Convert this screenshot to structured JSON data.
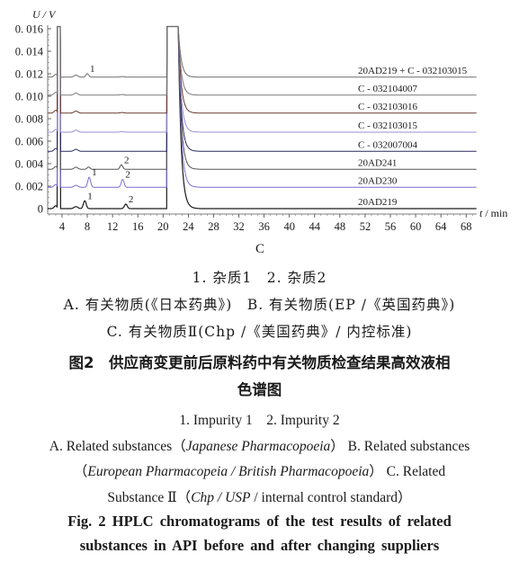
{
  "chart_data": {
    "type": "line",
    "panel": "C",
    "title": "",
    "xlabel": "t / min",
    "ylabel": "U / V",
    "xlim": [
      1.7,
      70
    ],
    "ylim": [
      -0.0005,
      0.016
    ],
    "x_ticks": [
      4,
      8,
      12,
      16,
      20,
      24,
      28,
      32,
      36,
      40,
      44,
      48,
      52,
      56,
      60,
      64,
      68
    ],
    "y_ticks": [
      0,
      0.002,
      0.004,
      0.006,
      0.008,
      0.01,
      0.012,
      0.014,
      0.016
    ],
    "y_tick_labels": [
      "0",
      "0. 002",
      "0. 004",
      "0. 006",
      "0. 008",
      "0. 010",
      "0. 012",
      "0. 014",
      "0. 016"
    ],
    "grid": false,
    "main_peak_time_min": 21.8,
    "solvent_peak_time_min": 3.5,
    "series": [
      {
        "name": "20AD219",
        "baseline": 0.0,
        "color": "#1a1a1a",
        "peaks": [
          {
            "label": "1",
            "time": 7.6,
            "height": 0.0007
          },
          {
            "label": "2",
            "time": 14.1,
            "height": 0.0004
          }
        ]
      },
      {
        "name": "20AD230",
        "baseline": 0.0019,
        "color": "#7b6fcf",
        "peaks": [
          {
            "label": "1",
            "time": 8.3,
            "height": 0.0009
          },
          {
            "label": "2",
            "time": 13.6,
            "height": 0.0007
          }
        ]
      },
      {
        "name": "20AD241",
        "baseline": 0.0035,
        "color": "#555555",
        "peaks": [
          {
            "label": "",
            "time": 8.2,
            "height": 0.0002
          },
          {
            "label": "2",
            "time": 13.4,
            "height": 0.0004
          }
        ]
      },
      {
        "name": "C - 032007004",
        "baseline": 0.0051,
        "color": "#2b2a5e",
        "peaks": []
      },
      {
        "name": "C - 032103015",
        "baseline": 0.0068,
        "color": "#9a8fd6",
        "peaks": []
      },
      {
        "name": "C - 032103016",
        "baseline": 0.0085,
        "color": "#6b3a2f",
        "peaks": []
      },
      {
        "name": "C - 032104007",
        "baseline": 0.0101,
        "color": "#7a7a7a",
        "peaks": []
      },
      {
        "name": "20AD219 + C - 032103015",
        "baseline": 0.0117,
        "color": "#6e6e6e",
        "peaks": [
          {
            "label": "1",
            "time": 8.0,
            "height": 0.0003
          }
        ]
      }
    ]
  },
  "captions": {
    "peak_legend_cn": "1. 杂质1　2. 杂质2",
    "methods_cn_line1": "A. 有关物质(《日本药典》)　B. 有关物质(EP /《英国药典》)",
    "methods_cn_line2": "C. 有关物质Ⅱ(Chp /《美国药典》/ 内控标准)",
    "figure_title_cn_line1": "图2　供应商变更前后原料药中有关物质检查结果高效液相",
    "figure_title_cn_line2": "色谱图",
    "peak_legend_en": "1. Impurity  1　2. Impurity  2",
    "methods_en_line1_a": "A. Related  substances（",
    "methods_en_line1_b": "Japanese  Pharmacopoeia",
    "methods_en_line1_c": "）  B. Related  substances",
    "methods_en_line2_a": "（",
    "methods_en_line2_b": "European  Pharmacopeia / British  Pharmacopoeia",
    "methods_en_line2_c": "）  C. Related",
    "methods_en_line3_a": "Substance  Ⅱ（",
    "methods_en_line3_b": "Chp / USP",
    "methods_en_line3_c": " / internal  control  standard）",
    "figure_title_en_line1": "Fig. 2   HPLC chromatograms of the test results of related",
    "figure_title_en_line2": "substances in API before and after changing suppliers"
  }
}
